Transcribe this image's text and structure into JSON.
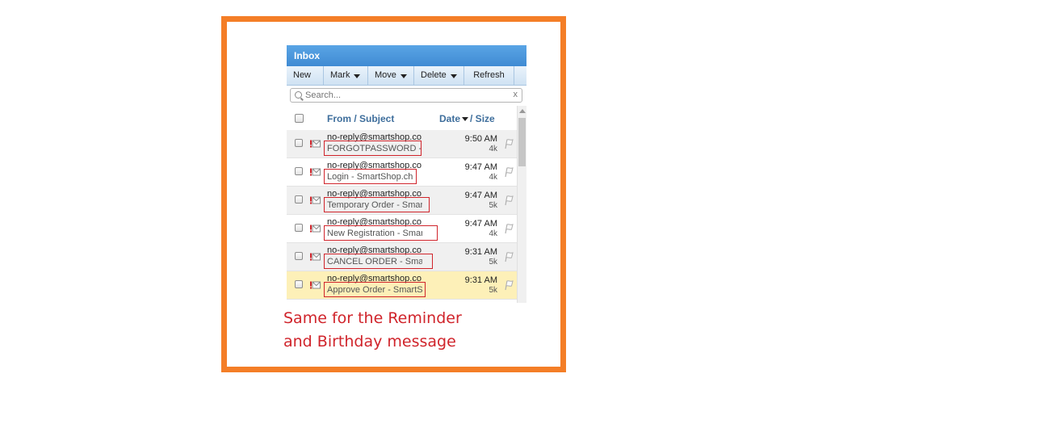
{
  "inbox": {
    "title": "Inbox",
    "toolbar": {
      "new_label": "New",
      "mark_label": "Mark",
      "move_label": "Move",
      "delete_label": "Delete",
      "refresh_label": "Refresh"
    },
    "search": {
      "placeholder": "Search...",
      "clear_label": "x"
    },
    "columns": {
      "from_subject": "From / Subject",
      "date": "Date",
      "size": "/ Size"
    },
    "messages": [
      {
        "sender": "no-reply@smartshop.co",
        "subject": "FORGOTPASSWORD - SmartShop.ch",
        "time": "9:50 AM",
        "size": "4k"
      },
      {
        "sender": "no-reply@smartshop.co",
        "subject": "Login - SmartShop.ch",
        "time": "9:47 AM",
        "size": "4k"
      },
      {
        "sender": "no-reply@smartshop.co",
        "subject": "Temporary Order - SmartShop.ch",
        "time": "9:47 AM",
        "size": "5k"
      },
      {
        "sender": "no-reply@smartshop.co",
        "subject": "New Registration - SmartShop.ch",
        "time": "9:47 AM",
        "size": "4k"
      },
      {
        "sender": "no-reply@smartshop.co",
        "subject": "CANCEL ORDER - SmartShop.ch",
        "time": "9:31 AM",
        "size": "5k"
      },
      {
        "sender": "no-reply@smartshop.co",
        "subject": "Approve Order - SmartShop.ch",
        "time": "9:31 AM",
        "size": "5k"
      }
    ]
  },
  "annotation": {
    "line1": "Same for the Reminder",
    "line2": "and Birthday message",
    "highlight_color": "#d0242b",
    "frame_color": "#f47e27"
  },
  "icons": {
    "envelope": "envelope-error-icon",
    "flag": "flag-icon",
    "search": "search-icon"
  }
}
